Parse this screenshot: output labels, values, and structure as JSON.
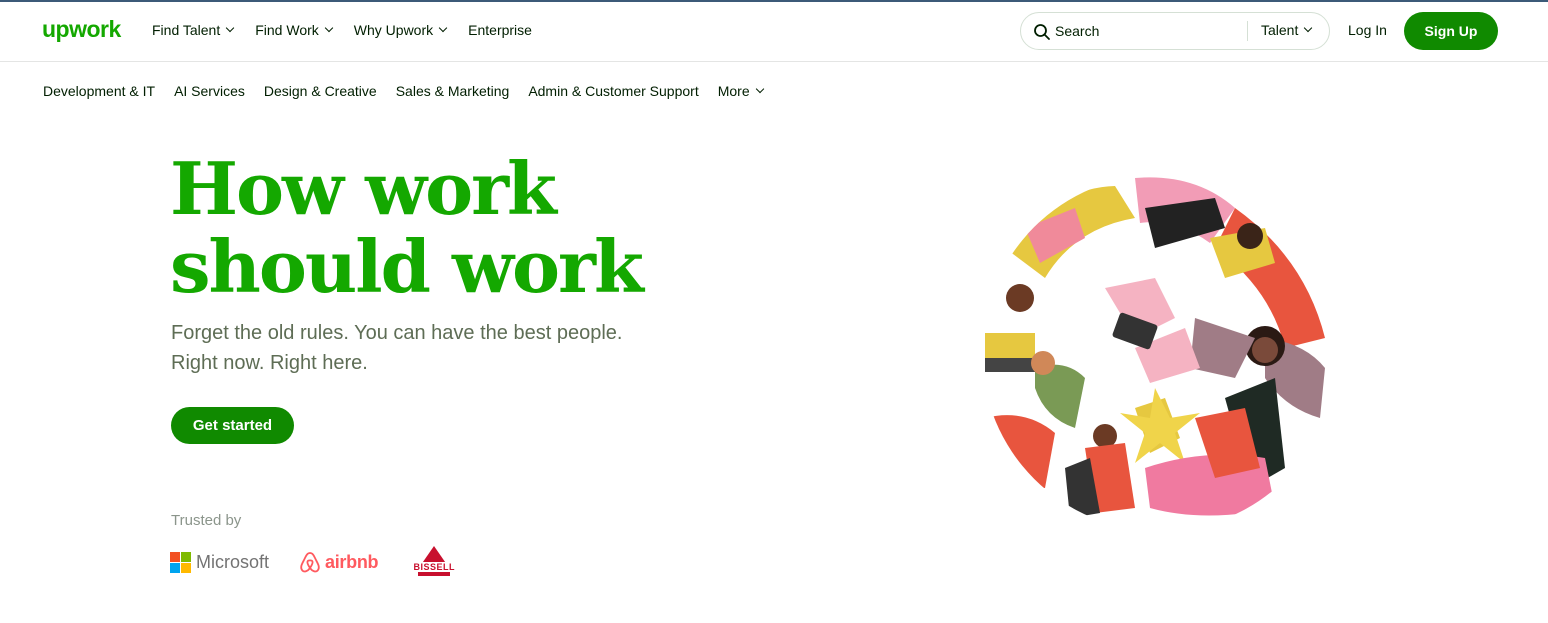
{
  "header": {
    "logo": "upwork",
    "nav": [
      {
        "label": "Find Talent",
        "dropdown": true
      },
      {
        "label": "Find Work",
        "dropdown": true
      },
      {
        "label": "Why Upwork",
        "dropdown": true
      },
      {
        "label": "Enterprise",
        "dropdown": false
      }
    ],
    "search": {
      "placeholder": "Search",
      "scope": "Talent"
    },
    "login": "Log In",
    "signup": "Sign Up"
  },
  "categories": [
    "Development & IT",
    "AI Services",
    "Design & Creative",
    "Sales & Marketing",
    "Admin & Customer Support",
    "More"
  ],
  "hero": {
    "title_line1": "How work",
    "title_line2": "should work",
    "subtitle_line1": "Forget the old rules. You can have the best people.",
    "subtitle_line2": "Right now. Right here.",
    "cta": "Get started"
  },
  "trusted": {
    "label": "Trusted by",
    "brands": [
      "Microsoft",
      "airbnb",
      "BISSELL"
    ]
  },
  "colors": {
    "brand_green": "#14a800",
    "button_green": "#108a00",
    "text_dark": "#001e00",
    "subtitle_gray": "#5e6d55",
    "airbnb_red": "#ff5a5f",
    "bissell_red": "#c8102e"
  },
  "icons": {
    "search": "search-icon",
    "chevron": "chevron-down-icon",
    "hero": "people-collage-illustration"
  }
}
